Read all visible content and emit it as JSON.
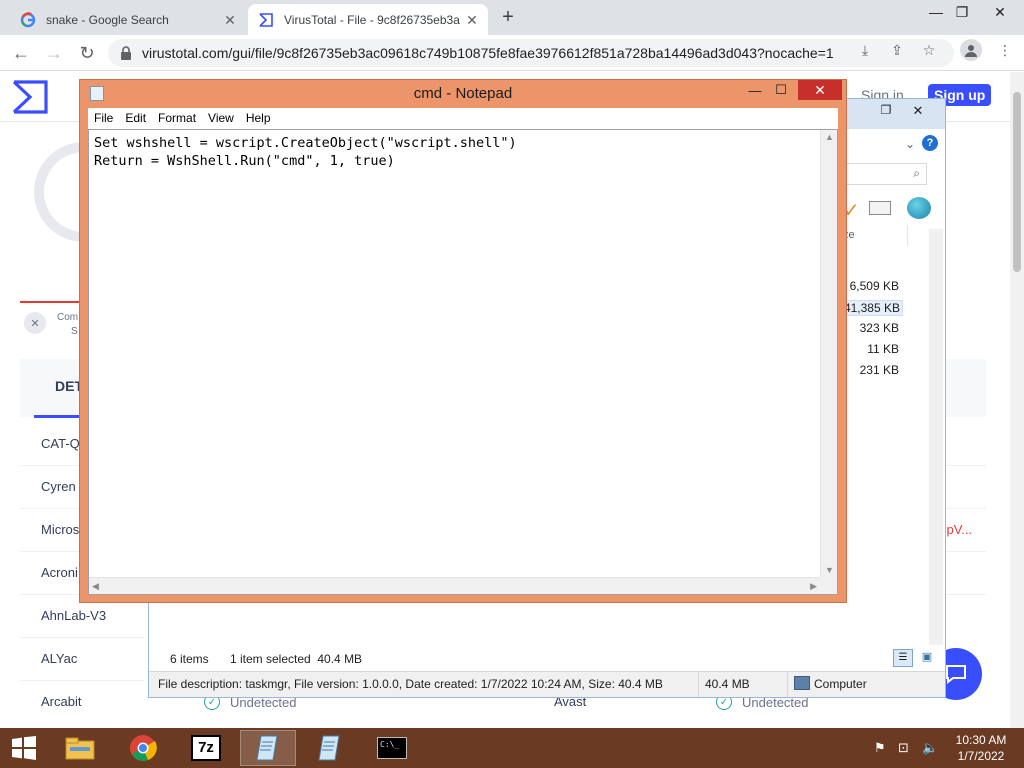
{
  "browser": {
    "tabs": [
      {
        "title": "snake - Google Search",
        "favicon": "google-g-icon"
      },
      {
        "title": "VirusTotal - File - 9c8f26735eb3a",
        "favicon": "virustotal-icon"
      }
    ],
    "url": "virustotal.com/gui/file/9c8f26735eb3ac09618c749b10875fe8fae3976612f851a728ba14496ad3d043?nocache=1"
  },
  "virustotal": {
    "sign_in": "Sign in",
    "sign_up": "Sign up",
    "side_fragment_1": "Com",
    "side_fragment_2": "S",
    "detection_tab": "DET",
    "right_fragment": "cpV...",
    "engines": [
      "CAT-Q",
      "Cyren",
      "Micros",
      "Acroni",
      "AhnLab-V3",
      "ALYac",
      "Arcabit"
    ],
    "bottom_row": {
      "status_left": "Undetected",
      "engine_right": "Avast",
      "status_right": "Undetected"
    }
  },
  "explorer": {
    "column_fragment": "ze",
    "sizes": [
      "6,509 KB",
      "41,385 KB",
      "323 KB",
      "11 KB",
      "231 KB"
    ],
    "status": {
      "items": "6 items",
      "selected": "1 item selected  40.4 MB",
      "description": "File description: taskmgr, File version: 1.0.0.0, Date created: 1/7/2022 10:24 AM, Size: 40.4 MB",
      "size": "40.4 MB",
      "location": "Computer"
    }
  },
  "notepad": {
    "title": "cmd - Notepad",
    "menu": [
      "File",
      "Edit",
      "Format",
      "View",
      "Help"
    ],
    "content": "Set wshshell = wscript.CreateObject(\"wscript.shell\")\nReturn = WshShell.Run(\"cmd\", 1, true)"
  },
  "taskbar": {
    "time": "10:30 AM",
    "date": "1/7/2022",
    "apps": [
      "start-button",
      "file-explorer-icon",
      "chrome-icon",
      "7zip-icon",
      "notepad-icon",
      "notepad-icon",
      "cmd-icon"
    ]
  }
}
